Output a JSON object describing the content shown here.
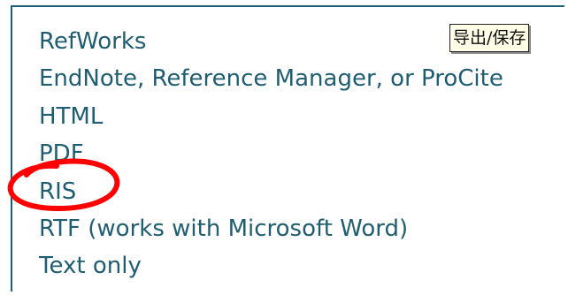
{
  "export_formats": {
    "items": [
      {
        "label": "RefWorks"
      },
      {
        "label": "EndNote, Reference Manager, or ProCite"
      },
      {
        "label": "HTML"
      },
      {
        "label": "PDF"
      },
      {
        "label": "RIS"
      },
      {
        "label": "RTF (works with Microsoft Word)"
      },
      {
        "label": "Text only"
      }
    ]
  },
  "tooltip": {
    "text": "导出/保存"
  },
  "colors": {
    "link": "#1f5d72",
    "panel_border": "#1c5f7a",
    "annotation": "#ff0000",
    "tooltip_bg": "#fffee6"
  }
}
